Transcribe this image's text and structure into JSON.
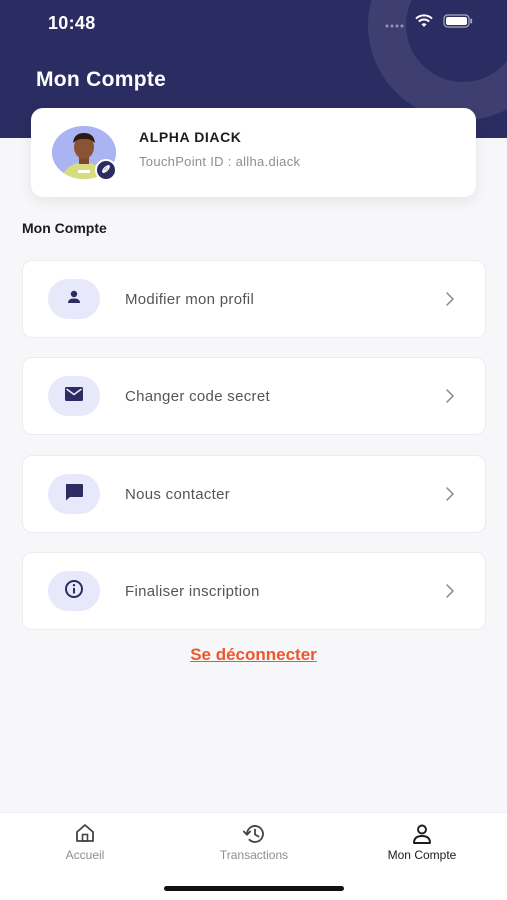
{
  "status_bar": {
    "time": "10:48"
  },
  "header": {
    "title": "Mon Compte"
  },
  "profile": {
    "name": "ALPHA DIACK",
    "touchpoint_id": "TouchPoint ID : allha.diack"
  },
  "section": {
    "title": "Mon Compte"
  },
  "menu": [
    {
      "label": "Modifier mon profil",
      "icon": "person-icon"
    },
    {
      "label": "Changer code secret",
      "icon": "mail-icon"
    },
    {
      "label": "Nous contacter",
      "icon": "chat-icon"
    },
    {
      "label": "Finaliser inscription",
      "icon": "info-icon"
    }
  ],
  "logout_label": "Se déconnecter",
  "tabs": [
    {
      "label": "Accueil",
      "icon": "home-icon",
      "active": false
    },
    {
      "label": "Transactions",
      "icon": "history-icon",
      "active": false
    },
    {
      "label": "Mon Compte",
      "icon": "account-icon",
      "active": true
    }
  ],
  "colors": {
    "header_bg": "#2b2d62",
    "accent": "#f0562b",
    "icon_bg": "#e7e9fb"
  }
}
